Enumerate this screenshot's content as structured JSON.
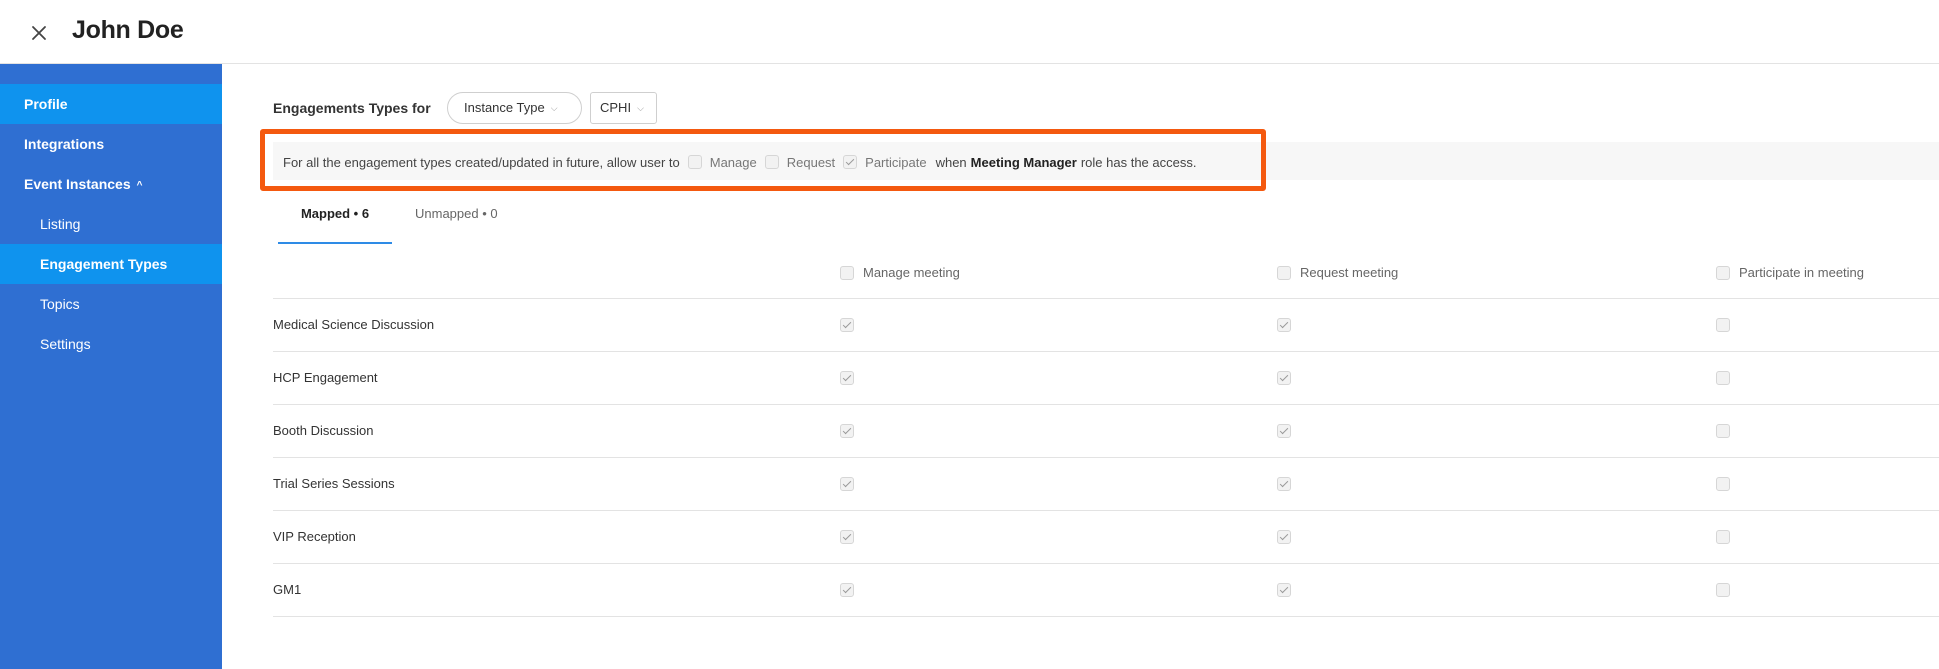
{
  "header": {
    "title": "John Doe",
    "close_icon": "close-icon"
  },
  "sidebar": {
    "items": [
      {
        "label": "Profile",
        "active": true
      },
      {
        "label": "Integrations",
        "active": false
      },
      {
        "label": "Event Instances",
        "active": false,
        "expanded": true
      },
      {
        "label": "Listing",
        "active": false
      },
      {
        "label": "Engagement Types",
        "active": true
      },
      {
        "label": "Topics",
        "active": false
      },
      {
        "label": "Settings",
        "active": false
      }
    ],
    "chevron": "^",
    "bg_color": "#2f6fd2",
    "active_color": "#0f93ee"
  },
  "main": {
    "engagements_label": "Engagements Types for",
    "instance_type": {
      "value": "Instance Type"
    },
    "instance": {
      "value": "CPHI"
    },
    "future": {
      "prefix": "For all the engagement types created/updated in future, allow user to",
      "options": [
        {
          "label": "Manage",
          "checked": false
        },
        {
          "label": "Request",
          "checked": false
        },
        {
          "label": "Participate",
          "checked": true
        }
      ],
      "when": "when",
      "role": "Meeting Manager",
      "suffix": "role has the access.",
      "highlight_color": "#f4590f"
    },
    "tabs": [
      {
        "label": "Mapped • 6",
        "active": true
      },
      {
        "label": "Unmapped • 0",
        "active": false
      }
    ],
    "columns": [
      "Manage meeting",
      "Request meeting",
      "Participate in meeting"
    ],
    "rows": [
      {
        "name": "Medical Science Discussion",
        "manage": true,
        "request": true,
        "participate": false
      },
      {
        "name": "HCP Engagement",
        "manage": true,
        "request": true,
        "participate": false
      },
      {
        "name": "Booth Discussion",
        "manage": true,
        "request": true,
        "participate": false
      },
      {
        "name": "Trial Series Sessions",
        "manage": true,
        "request": true,
        "participate": false
      },
      {
        "name": "VIP Reception",
        "manage": true,
        "request": true,
        "participate": false
      },
      {
        "name": "GM1",
        "manage": true,
        "request": true,
        "participate": false
      }
    ]
  }
}
